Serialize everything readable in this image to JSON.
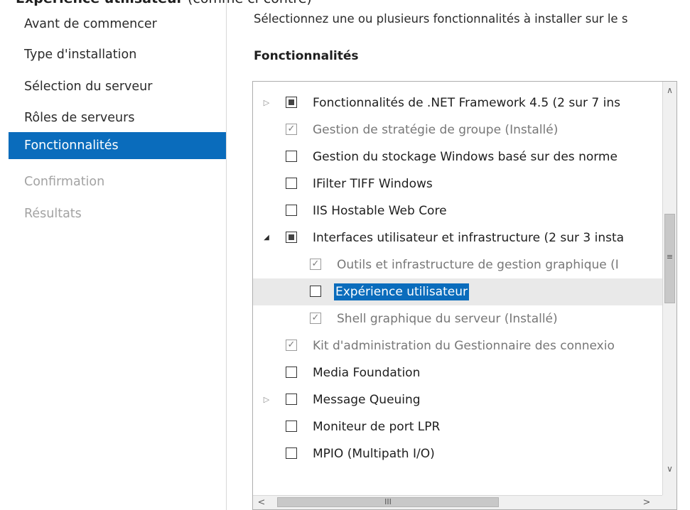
{
  "caption": {
    "bold": "Expérience utilisateur",
    "rest": " (comme ci-contre)"
  },
  "nav": {
    "items": [
      {
        "label": "Avant de commencer",
        "state": "normal"
      },
      {
        "label": "Type d'installation",
        "state": "normal"
      },
      {
        "label": "Sélection du serveur",
        "state": "normal"
      },
      {
        "label": "Rôles de serveurs",
        "state": "normal"
      },
      {
        "label": "Fonctionnalités",
        "state": "active"
      },
      {
        "label": "Confirmation",
        "state": "disabled"
      },
      {
        "label": "Résultats",
        "state": "disabled"
      }
    ]
  },
  "main": {
    "description": "Sélectionnez une ou plusieurs fonctionnalités à installer sur le s",
    "section_title": "Fonctionnalités",
    "features": [
      {
        "label": "Fonctionnalités de .NET Framework 4.5 (2 sur 7 ins",
        "indent": 0,
        "expander": "collapsed",
        "check": "partial",
        "grayed": false
      },
      {
        "label": "Gestion de stratégie de groupe (Installé)",
        "indent": 0,
        "expander": "none",
        "check": "checked",
        "grayed": true
      },
      {
        "label": "Gestion du stockage Windows basé sur des norme",
        "indent": 0,
        "expander": "none",
        "check": "unchecked",
        "grayed": false
      },
      {
        "label": "IFilter TIFF Windows",
        "indent": 0,
        "expander": "none",
        "check": "unchecked",
        "grayed": false
      },
      {
        "label": "IIS Hostable Web Core",
        "indent": 0,
        "expander": "none",
        "check": "unchecked",
        "grayed": false
      },
      {
        "label": "Interfaces utilisateur et infrastructure (2 sur 3 insta",
        "indent": 0,
        "expander": "expanded",
        "check": "partial",
        "grayed": false
      },
      {
        "label": "Outils et infrastructure de gestion graphique (I",
        "indent": 1,
        "expander": "none",
        "check": "checked",
        "grayed": true
      },
      {
        "label": "Expérience utilisateur",
        "indent": 1,
        "expander": "none",
        "check": "unchecked",
        "grayed": false,
        "selected": true
      },
      {
        "label": "Shell graphique du serveur (Installé)",
        "indent": 1,
        "expander": "none",
        "check": "checked",
        "grayed": true
      },
      {
        "label": "Kit d'administration du Gestionnaire des connexio",
        "indent": 0,
        "expander": "none",
        "check": "checked",
        "grayed": true
      },
      {
        "label": "Media Foundation",
        "indent": 0,
        "expander": "none",
        "check": "unchecked",
        "grayed": false
      },
      {
        "label": "Message Queuing",
        "indent": 0,
        "expander": "collapsed",
        "check": "unchecked",
        "grayed": false
      },
      {
        "label": "Moniteur de port LPR",
        "indent": 0,
        "expander": "none",
        "check": "unchecked",
        "grayed": false
      },
      {
        "label": "MPIO (Multipath I/O)",
        "indent": 0,
        "expander": "none",
        "check": "unchecked",
        "grayed": false
      }
    ]
  },
  "icons": {
    "expander_collapsed": "triangle-right-icon",
    "expander_expanded": "triangle-down-icon",
    "scroll_up": "chevron-up-icon",
    "scroll_down": "chevron-down-icon",
    "scroll_left": "chevron-left-icon",
    "scroll_right": "chevron-right-icon"
  },
  "colors": {
    "accent": "#0a6cbc",
    "disabled_text": "#a3a3a3"
  }
}
